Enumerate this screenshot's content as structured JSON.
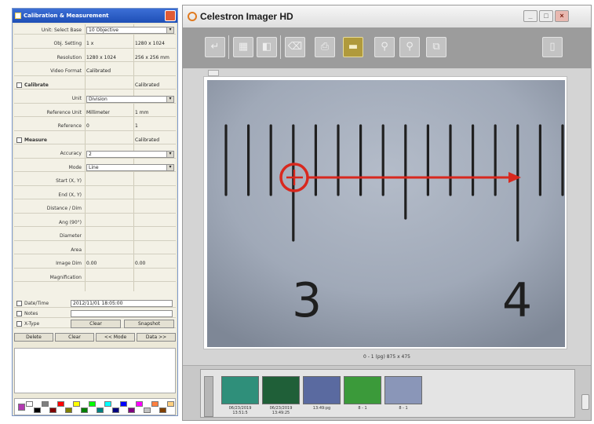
{
  "calibration_panel": {
    "title": "Calibration & Measurement",
    "rows": [
      {
        "label": "Unit: Select Base",
        "v1": "10 Objective",
        "type": "dropdown"
      },
      {
        "label": "Obj. Setting",
        "v1": "1 x",
        "v2": "1280 x 1024"
      },
      {
        "label": "Resolution",
        "v1": "1280 x 1024",
        "v2": "256 x 256 mm"
      },
      {
        "label": "Video Format",
        "v1": "Calibrated",
        "v2": ""
      },
      {
        "label": "Calibrate",
        "v1": "",
        "v2": "Calibrated",
        "check": true
      },
      {
        "label": "Unit",
        "v1": "Division",
        "type": "dropdown"
      },
      {
        "label": "Reference Unit",
        "v1": "Millimeter",
        "v2": "1 mm"
      },
      {
        "label": "Reference",
        "v1": "0",
        "v2": "1"
      },
      {
        "label": "Measure",
        "v1": "",
        "v2": "Calibrated",
        "check": true
      },
      {
        "label": "Accuracy",
        "v1": "2",
        "type": "dropdown"
      },
      {
        "label": "Mode",
        "v1": "Line",
        "type": "dropdown"
      },
      {
        "label": "Start (X, Y)",
        "v1": "",
        "v2": ""
      },
      {
        "label": "End (X, Y)",
        "v1": "",
        "v2": ""
      },
      {
        "label": "Distance / Dim",
        "v1": "",
        "v2": ""
      },
      {
        "label": "Ang (90°)",
        "v1": "",
        "v2": ""
      },
      {
        "label": "Diameter",
        "v1": "",
        "v2": ""
      },
      {
        "label": "Area",
        "v1": "",
        "v2": ""
      },
      {
        "label": "Image Dim",
        "v1": "0.00",
        "v2": "0.00"
      },
      {
        "label": "Magnification",
        "v1": "",
        "v2": ""
      }
    ],
    "date_time_label": "Date/Time",
    "date_time_value": "2012/11/01 18:05:00",
    "notes_label": "Notes",
    "x_type_label": "X-Type",
    "clear_label": "Clear",
    "snapshot_label": "Snapshot",
    "buttons": [
      "Delete",
      "Clear",
      "<< Mode",
      "Data >>"
    ],
    "palette_colors": [
      "#b23ab0",
      "#ffffff",
      "#000000",
      "#7f7f7f",
      "#7f0000",
      "#ff0000",
      "#7f7f00",
      "#ffff00",
      "#007f00",
      "#00ff00",
      "#007f7f",
      "#00ffff",
      "#00007f",
      "#0000ff",
      "#7f007f",
      "#ff00ff",
      "#c0c0c0",
      "#ff8040",
      "#804000",
      "#ffd080"
    ]
  },
  "imager_window": {
    "title": "Celestron Imager HD",
    "controls": [
      "_",
      "□",
      "×"
    ],
    "toolbar_icons": [
      "arrow-icon",
      "film-icon",
      "dual-frame-icon",
      "trash-icon",
      "printer-icon",
      "photo-icon",
      "zoom-in-icon",
      "zoom-out-icon",
      "copy-icon",
      "panel-icon"
    ],
    "ruler_numbers": [
      "3",
      "4"
    ],
    "caption": "0 - 1 (pg) 875 x 475",
    "thumbnails": [
      {
        "caption_line1": "06/23/2019",
        "caption_line2": "13:51:5",
        "color": "#2f8f7a"
      },
      {
        "caption_line1": "06/23/2019",
        "caption_line2": "13:49:25",
        "color": "#1f5f38"
      },
      {
        "caption_line1": "13:49:pg",
        "caption_line2": "",
        "color": "#5a6aa0"
      },
      {
        "caption_line1": "8 - 1",
        "caption_line2": "",
        "color": "#3b9a3a"
      },
      {
        "caption_line1": "8 - 1",
        "caption_line2": "",
        "color": "#8a96b8"
      }
    ]
  }
}
